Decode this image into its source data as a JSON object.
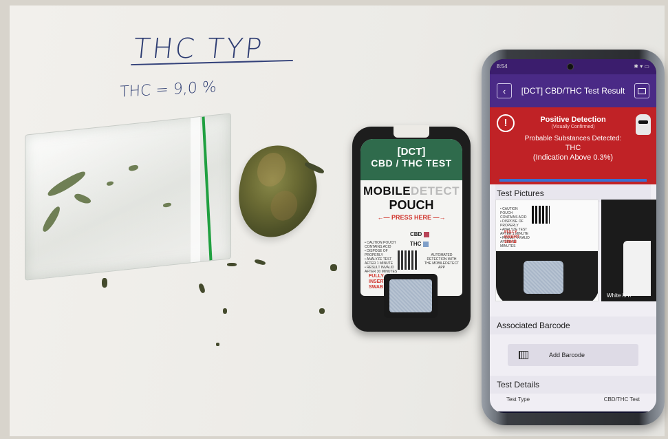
{
  "handwriting": {
    "title": "THC TYP",
    "line": "THC = 9,0 %"
  },
  "pouch": {
    "header_line1": "[DCT]",
    "header_line2": "CBD / THC TEST",
    "brand_part1": "MOBILE",
    "brand_part2": "DETECT",
    "title": "POUCH",
    "press_here": "←— PRESS HERE —→",
    "legend_cbd": "CBD",
    "legend_thc": "THC",
    "instructions": "• CAUTION POUCH CONTAINS ACID\n• DISPOSE OF PROPERLY\n• ANALYZE TEST AFTER 1 MINUTE\n• RESULT INVALID AFTER 30 MINUTES",
    "detection_note": "AUTOMATED DETECTION WITH THE MOBILEDETECT APP",
    "insert_note": "FULLY INSERT SWAB",
    "colors": {
      "header": "#2f6b4c",
      "cbd": "#b84458",
      "thc": "#7f9fc8"
    }
  },
  "phone": {
    "status_time": "8:54",
    "status_icons": "✱ ▾ ▭",
    "app_title": "[DCT] CBD/THC Test Result",
    "back_icon": "‹",
    "alert": {
      "title": "Positive Detection",
      "subtitle": "(Visually Confirmed)",
      "probable_label": "Probable Substances Detected:",
      "substance": "THC",
      "indication": "(Indication Above 0.3%)",
      "icon": "!"
    },
    "test_pictures_label": "Test Pictures",
    "picture_caption": "White is n",
    "picture_insert_note": "FULLY INSERT SWAB",
    "associated_barcode_label": "Associated Barcode",
    "add_barcode_label": "Add Barcode",
    "test_details_label": "Test Details",
    "details": {
      "test_type_label": "Test Type",
      "test_type_value": "CBD/THC Test"
    },
    "colors": {
      "appbar": "#4a2a86",
      "alert": "#c02226"
    }
  }
}
